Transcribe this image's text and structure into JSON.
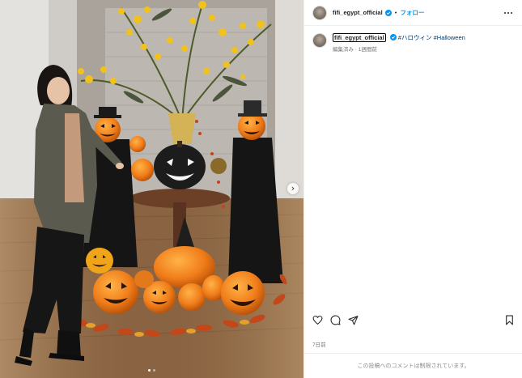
{
  "post": {
    "username": "fifi_egypt_official",
    "separator": "•",
    "follow_label": "フォロー",
    "caption_rest": "#ハロウィン #Halloween",
    "edited_meta": "編集済み · 1週間前",
    "posted_ago": "7日前",
    "comments_disabled": "この投稿へのコメントは制限されています。"
  },
  "icons": {
    "verified": "verified-badge-icon",
    "more": "more-options-icon",
    "like": "heart-icon",
    "comment": "comment-icon",
    "share": "share-icon",
    "save": "bookmark-icon",
    "next": "chevron-right-icon"
  },
  "colors": {
    "accent": "#0095f6",
    "hashtag": "#00376b",
    "muted": "#737373",
    "border": "#efefef"
  },
  "carousel": {
    "next_glyph": "›",
    "slide_count": 2,
    "active_slide": 1
  }
}
